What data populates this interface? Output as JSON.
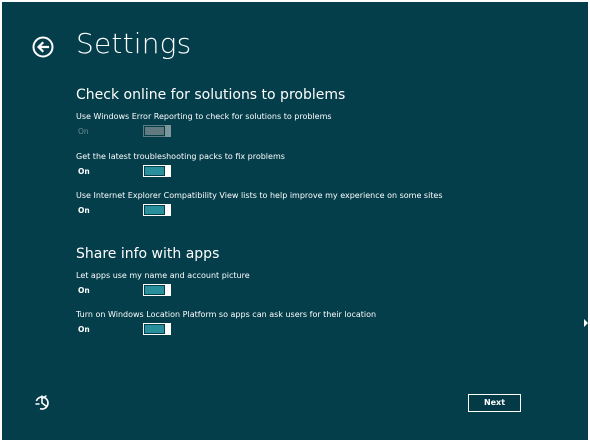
{
  "header": {
    "title": "Settings",
    "back_icon": "back-arrow-circle-icon"
  },
  "sections": [
    {
      "title": "Check online for solutions to problems",
      "settings": [
        {
          "label": "Use Windows Error Reporting to check for solutions to problems",
          "state": "On",
          "enabled": false
        },
        {
          "label": "Get the latest troubleshooting packs to fix problems",
          "state": "On",
          "enabled": true
        },
        {
          "label": "Use Internet Explorer Compatibility View lists to help improve my experience on some sites",
          "state": "On",
          "enabled": true
        }
      ]
    },
    {
      "title": "Share info with apps",
      "settings": [
        {
          "label": "Let apps use my name and account picture",
          "state": "On",
          "enabled": true
        },
        {
          "label": "Turn on Windows Location Platform so apps can ask users for their location",
          "state": "On",
          "enabled": true
        }
      ]
    }
  ],
  "footer": {
    "ease_of_access_icon": "ease-of-access-icon",
    "next_label": "Next"
  },
  "colors": {
    "background": "#053e4b",
    "toggle_fill": "#2a8f9c",
    "text": "#ffffff"
  }
}
